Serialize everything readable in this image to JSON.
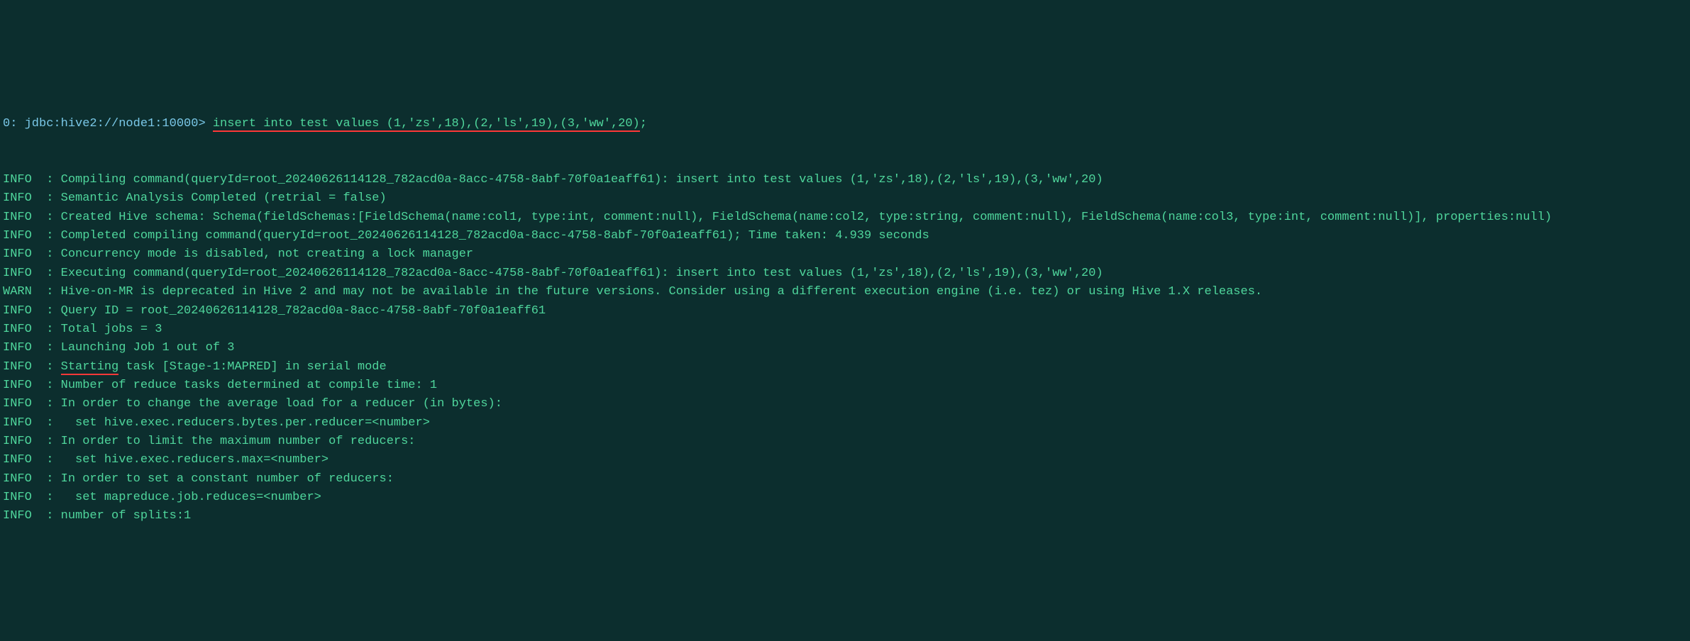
{
  "prompt": "0: jdbc:hive2://node1:10000>",
  "command": "insert into test values (1,'zs',18),(2,'ls',19),(3,'ww',20);",
  "command_underlined": "insert into test values (1,'zs',18),(2,'ls',19),(3,'ww',20)",
  "command_tail": ";",
  "lines": [
    {
      "label": "INFO",
      "text": "  : Compiling command(queryId=root_20240626114128_782acd0a-8acc-4758-8abf-70f0a1eaff61): insert into test values (1,'zs',18),(2,'ls',19),(3,'ww',20)"
    },
    {
      "label": "INFO",
      "text": "  : Semantic Analysis Completed (retrial = false)"
    },
    {
      "label": "INFO",
      "text": "  : Created Hive schema: Schema(fieldSchemas:[FieldSchema(name:col1, type:int, comment:null), FieldSchema(name:col2, type:string, comment:null), FieldSchema(name:col3, type:int, comment:null)], properties:null)"
    },
    {
      "label": "INFO",
      "text": "  : Completed compiling command(queryId=root_20240626114128_782acd0a-8acc-4758-8abf-70f0a1eaff61); Time taken: 4.939 seconds"
    },
    {
      "label": "INFO",
      "text": "  : Concurrency mode is disabled, not creating a lock manager"
    },
    {
      "label": "INFO",
      "text": "  : Executing command(queryId=root_20240626114128_782acd0a-8acc-4758-8abf-70f0a1eaff61): insert into test values (1,'zs',18),(2,'ls',19),(3,'ww',20)"
    },
    {
      "label": "WARN",
      "text": "  : Hive-on-MR is deprecated in Hive 2 and may not be available in the future versions. Consider using a different execution engine (i.e. tez) or using Hive 1.X releases."
    },
    {
      "label": "INFO",
      "text": "  : Query ID = root_20240626114128_782acd0a-8acc-4758-8abf-70f0a1eaff61"
    },
    {
      "label": "INFO",
      "text": "  : Total jobs = 3"
    },
    {
      "label": "INFO",
      "text": "  : Launching Job 1 out of 3"
    },
    {
      "label": "INFO",
      "text": "  : ",
      "underlined": "Starting",
      "text_after": " task [Stage-1:MAPRED] in serial mode"
    },
    {
      "label": "INFO",
      "text": "  : Number of reduce tasks determined at compile time: 1"
    },
    {
      "label": "INFO",
      "text": "  : In order to change the average load for a reducer (in bytes):"
    },
    {
      "label": "INFO",
      "text": "  :   set hive.exec.reducers.bytes.per.reducer=<number>"
    },
    {
      "label": "INFO",
      "text": "  : In order to limit the maximum number of reducers:"
    },
    {
      "label": "INFO",
      "text": "  :   set hive.exec.reducers.max=<number>"
    },
    {
      "label": "INFO",
      "text": "  : In order to set a constant number of reducers:"
    },
    {
      "label": "INFO",
      "text": "  :   set mapreduce.job.reduces=<number>"
    },
    {
      "label": "INFO",
      "text": "  : number of splits:1"
    }
  ]
}
